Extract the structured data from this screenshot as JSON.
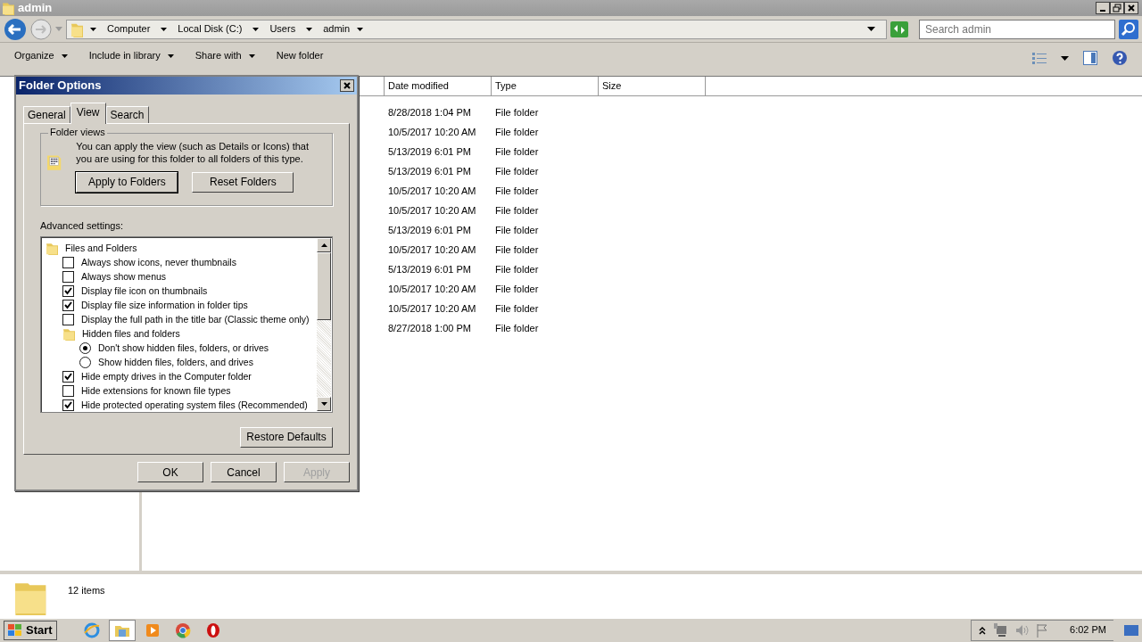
{
  "window": {
    "title": "admin"
  },
  "address_bar": {
    "crumbs": [
      "Computer",
      "Local Disk (C:)",
      "Users",
      "admin"
    ]
  },
  "search": {
    "placeholder": "Search admin"
  },
  "toolbar": [
    {
      "label": "Organize",
      "dropdown": true
    },
    {
      "label": "Include in library",
      "dropdown": true
    },
    {
      "label": "Share with",
      "dropdown": true
    },
    {
      "label": "New folder",
      "dropdown": false
    }
  ],
  "columns": [
    "Date modified",
    "Type",
    "Size"
  ],
  "rows": [
    {
      "date_modified": "8/28/2018 1:04 PM",
      "type": "File folder"
    },
    {
      "date_modified": "10/5/2017 10:20 AM",
      "type": "File folder"
    },
    {
      "date_modified": "5/13/2019 6:01 PM",
      "type": "File folder"
    },
    {
      "date_modified": "5/13/2019 6:01 PM",
      "type": "File folder"
    },
    {
      "date_modified": "10/5/2017 10:20 AM",
      "type": "File folder"
    },
    {
      "date_modified": "10/5/2017 10:20 AM",
      "type": "File folder"
    },
    {
      "date_modified": "5/13/2019 6:01 PM",
      "type": "File folder"
    },
    {
      "date_modified": "10/5/2017 10:20 AM",
      "type": "File folder"
    },
    {
      "date_modified": "5/13/2019 6:01 PM",
      "type": "File folder"
    },
    {
      "date_modified": "10/5/2017 10:20 AM",
      "type": "File folder"
    },
    {
      "date_modified": "10/5/2017 10:20 AM",
      "type": "File folder"
    },
    {
      "date_modified": "8/27/2018 1:00 PM",
      "type": "File folder"
    }
  ],
  "details_pane": {
    "count": "12 items"
  },
  "dialog": {
    "title": "Folder Options",
    "tabs": [
      {
        "label": "General",
        "selected": false
      },
      {
        "label": "View",
        "selected": true
      },
      {
        "label": "Search",
        "selected": false
      }
    ],
    "folder_views": {
      "legend": "Folder views",
      "text": "You can apply the view (such as Details or Icons) that you are using for this folder to all folders of this type.",
      "buttons": [
        {
          "label": "Apply to Folders",
          "default": true
        },
        {
          "label": "Reset Folders",
          "default": false
        }
      ]
    },
    "advanced_label": "Advanced settings:",
    "settings": [
      {
        "kind": "group",
        "label": "Files and Folders",
        "children": [
          {
            "kind": "checkbox",
            "label": "Always show icons, never thumbnails",
            "checked": false
          },
          {
            "kind": "checkbox",
            "label": "Always show menus",
            "checked": false
          },
          {
            "kind": "checkbox",
            "label": "Display file icon on thumbnails",
            "checked": true
          },
          {
            "kind": "checkbox",
            "label": "Display file size information in folder tips",
            "checked": true
          },
          {
            "kind": "checkbox",
            "label": "Display the full path in the title bar (Classic theme only)",
            "checked": false
          },
          {
            "kind": "group",
            "label": "Hidden files and folders",
            "children": [
              {
                "kind": "radio",
                "label": "Don't show hidden files, folders, or drives",
                "selected": true
              },
              {
                "kind": "radio",
                "label": "Show hidden files, folders, and drives",
                "selected": false
              }
            ]
          },
          {
            "kind": "checkbox",
            "label": "Hide empty drives in the Computer folder",
            "checked": true
          },
          {
            "kind": "checkbox",
            "label": "Hide extensions for known file types",
            "checked": false
          },
          {
            "kind": "checkbox",
            "label": "Hide protected operating system files (Recommended)",
            "checked": true
          }
        ]
      }
    ],
    "restore_button": "Restore Defaults",
    "footer_buttons": [
      {
        "label": "OK",
        "disabled": false
      },
      {
        "label": "Cancel",
        "disabled": false
      },
      {
        "label": "Apply",
        "disabled": true
      }
    ]
  },
  "taskbar": {
    "start": "Start",
    "items": [
      {
        "kind": "ie",
        "selected": false
      },
      {
        "kind": "explorer",
        "selected": true
      },
      {
        "kind": "media",
        "selected": false
      },
      {
        "kind": "chrome",
        "selected": false
      },
      {
        "kind": "opera",
        "selected": false
      }
    ],
    "clock": "6:02 PM"
  }
}
